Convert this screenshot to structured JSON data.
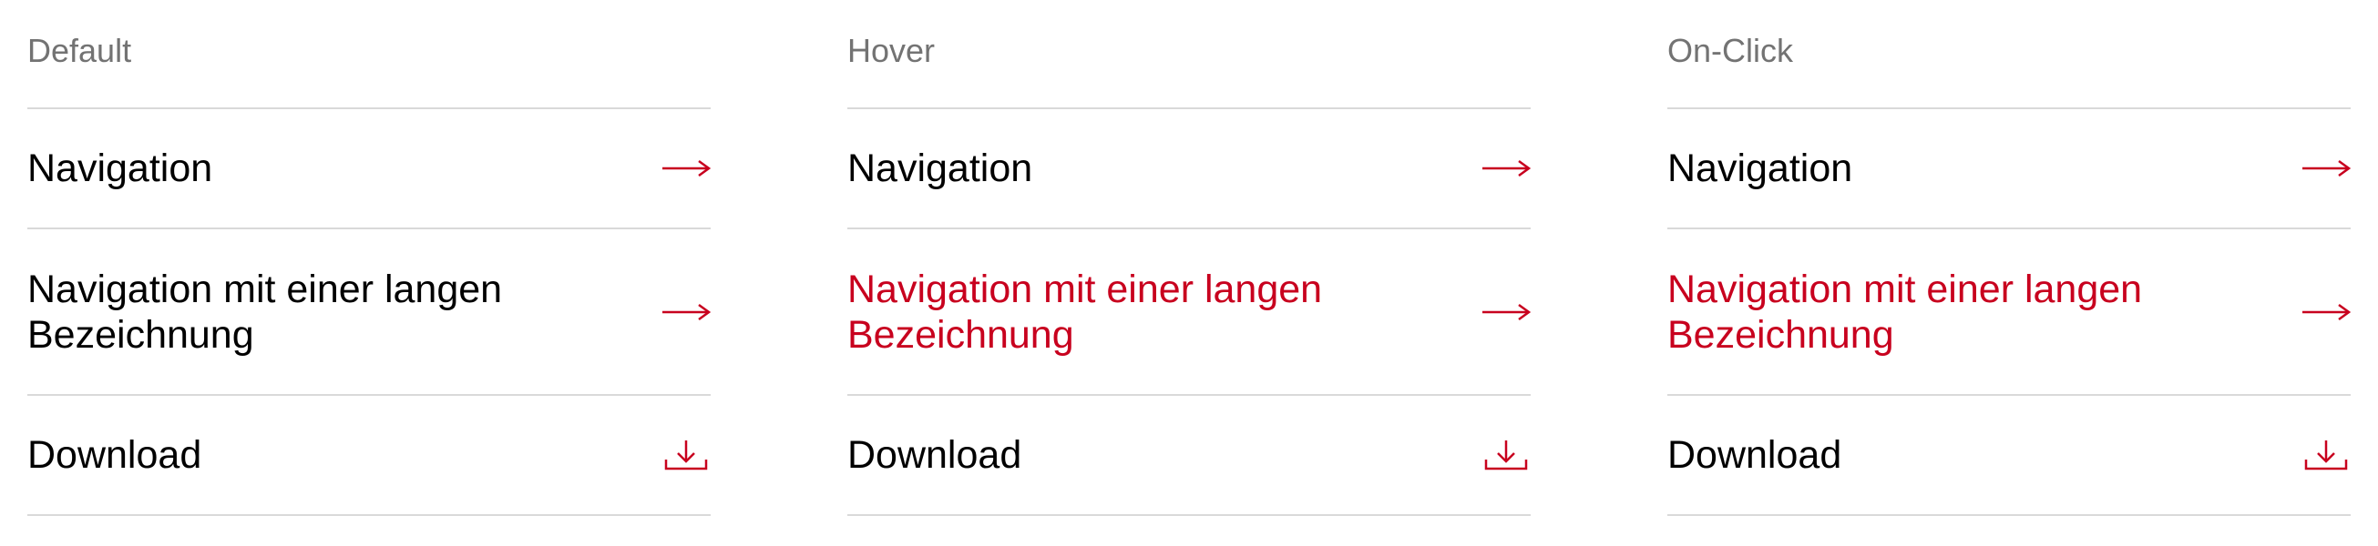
{
  "colors": {
    "accent": "#c8001e",
    "text": "#000000",
    "heading": "#737373",
    "divider": "#d9d9d9"
  },
  "columns": [
    {
      "heading": "Default",
      "rows": [
        {
          "label": "Navigation",
          "icon": "arrow-right-icon"
        },
        {
          "label": "Navigation mit einer langen Bezeichnung",
          "icon": "arrow-right-icon"
        },
        {
          "label": "Download",
          "icon": "download-icon"
        }
      ]
    },
    {
      "heading": "Hover",
      "rows": [
        {
          "label": "Navigation",
          "icon": "arrow-right-icon"
        },
        {
          "label": "Navigation mit einer langen Bezeichnung",
          "icon": "arrow-right-icon"
        },
        {
          "label": "Download",
          "icon": "download-icon"
        }
      ]
    },
    {
      "heading": "On-Click",
      "rows": [
        {
          "label": "Navigation",
          "icon": "arrow-right-icon"
        },
        {
          "label": "Navigation mit einer langen Bezeichnung",
          "icon": "arrow-right-icon"
        },
        {
          "label": "Download",
          "icon": "download-icon"
        }
      ]
    }
  ]
}
